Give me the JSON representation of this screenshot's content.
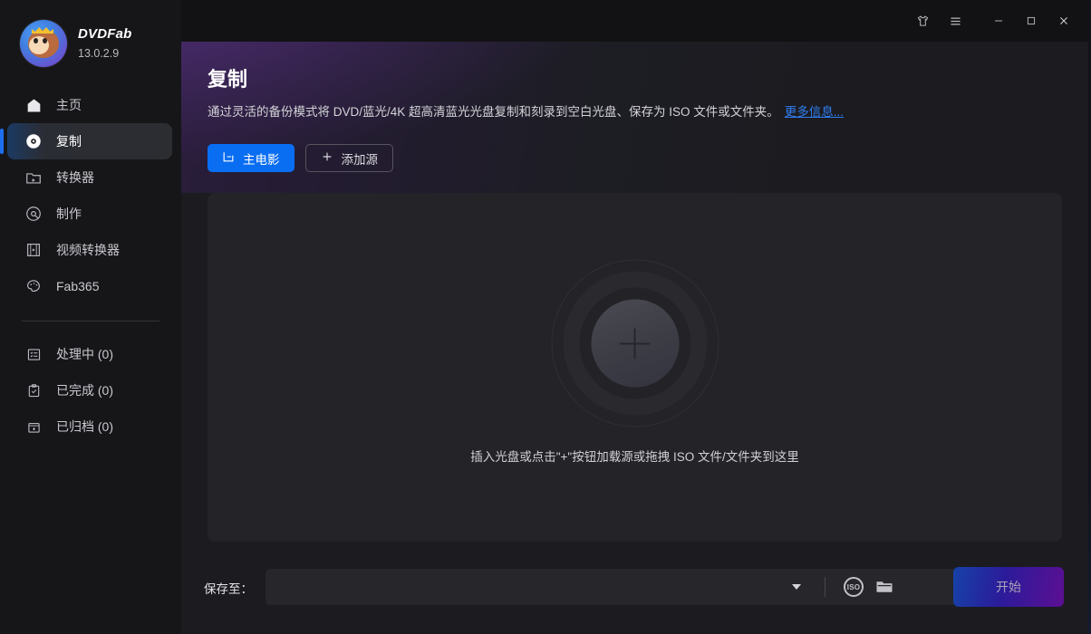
{
  "window": {
    "controls": [
      {
        "name": "skin-icon",
        "label": "皮肤"
      },
      {
        "name": "menu-icon",
        "label": "菜单"
      },
      {
        "name": "minimize-icon",
        "label": "最小化"
      },
      {
        "name": "maximize-icon",
        "label": "最大化"
      },
      {
        "name": "close-icon",
        "label": "关闭"
      }
    ]
  },
  "sidebar": {
    "brand_name": "DVDFab",
    "version": "13.0.2.9",
    "items": [
      {
        "label": "主页",
        "icon": "home-icon",
        "active": false
      },
      {
        "label": "复制",
        "icon": "disc-copy-icon",
        "active": true
      },
      {
        "label": "转换器",
        "icon": "ripper-icon",
        "active": false
      },
      {
        "label": "制作",
        "icon": "creator-disc-icon",
        "active": false
      },
      {
        "label": "视频转换器",
        "icon": "film-strip-icon",
        "active": false
      },
      {
        "label": "Fab365",
        "icon": "palette-icon",
        "active": false
      }
    ],
    "queue_items": [
      {
        "label": "处理中 (0)",
        "icon": "processing-list-icon"
      },
      {
        "label": "已完成 (0)",
        "icon": "clipboard-check-icon"
      },
      {
        "label": "已归档 (0)",
        "icon": "archive-box-icon"
      }
    ]
  },
  "hero": {
    "title": "复制",
    "description": "通过灵活的备份模式将 DVD/蓝光/4K 超高清蓝光光盘复制和刻录到空白光盘、保存为 ISO 文件或文件夹。",
    "more_link": "更多信息..."
  },
  "modes": {
    "main_movie_label": "主电影",
    "add_source_label": "添加源"
  },
  "dropzone": {
    "hint": "插入光盘或点击\"+\"按钮加载源或拖拽 ISO 文件/文件夹到这里",
    "plus_icon": "plus-icon"
  },
  "bottom": {
    "save_to_label": "保存至：",
    "path_value": "",
    "path_placeholder": "",
    "iso_icon_label": "ISO",
    "folder_icon": "folder-icon",
    "caret_icon": "chevron-down-icon",
    "start_label": "开始"
  },
  "colors": {
    "accent_blue": "#0a6ef2",
    "link_blue": "#2f7ef0",
    "sidebar_bg": "#161619",
    "pane_bg": "#1b1b20",
    "panel_bg": "#242428",
    "titlebar_bg": "#121214",
    "start_gradient_from": "#1642a8",
    "start_gradient_to": "#5c0f92"
  }
}
